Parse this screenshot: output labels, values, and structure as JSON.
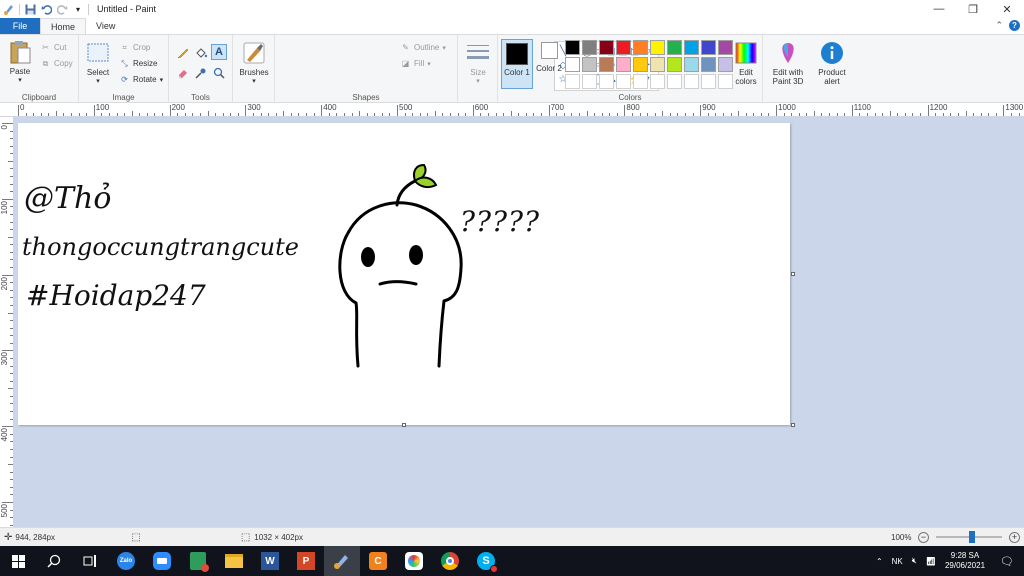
{
  "window": {
    "title": "Untitled - Paint",
    "controls": [
      "minimize-icon",
      "restore-icon",
      "close-icon"
    ]
  },
  "tabs": {
    "file": "File",
    "home": "Home",
    "view": "View"
  },
  "ribbon": {
    "clipboard": {
      "label": "Clipboard",
      "paste": "Paste",
      "cut": "Cut",
      "copy": "Copy"
    },
    "image": {
      "label": "Image",
      "select": "Select",
      "crop": "Crop",
      "resize": "Resize",
      "rotate": "Rotate"
    },
    "tools": {
      "label": "Tools"
    },
    "brushes": {
      "label": "Brushes"
    },
    "shapes": {
      "label": "Shapes",
      "outline": "Outline",
      "fill": "Fill"
    },
    "size": {
      "label": "Size"
    },
    "colors": {
      "label": "Colors",
      "color1": "Color 1",
      "color2": "Color 2",
      "color1_value": "#000000",
      "color2_value": "#ffffff",
      "palette": [
        "#000000",
        "#7f7f7f",
        "#880015",
        "#ed1c24",
        "#ff7f27",
        "#fff200",
        "#22b14c",
        "#00a2e8",
        "#3f48cc",
        "#a349a4",
        "#ffffff",
        "#c3c3c3",
        "#b97a57",
        "#ffaec9",
        "#ffc90e",
        "#efe4b0",
        "#b5e61d",
        "#99d9ea",
        "#7092be",
        "#c8bfe7"
      ],
      "edit_colors": "Edit colors"
    },
    "paint3d": "Edit with Paint 3D",
    "product_alert": "Product alert"
  },
  "ruler": {
    "h_labels": [
      "0",
      "100",
      "200",
      "300",
      "400",
      "500",
      "600",
      "700",
      "800",
      "900",
      "1000",
      "1100",
      "1200",
      "1300"
    ],
    "v_labels": [
      "0",
      "100",
      "200",
      "300",
      "400",
      "500"
    ]
  },
  "canvas": {
    "line1": "@Thỏ",
    "line2": "thongoccungtrangcute",
    "line3": "#Hoidap247",
    "question": "?????"
  },
  "status": {
    "cursor_pos": "944, 284px",
    "canvas_size": "1032 × 402px",
    "zoom": "100%",
    "zoom_level": 0.55
  },
  "taskbar": {
    "apps": [
      "windows-start-icon",
      "search-icon",
      "task-view-icon",
      "zalo-icon",
      "zoom-icon",
      "app-icon",
      "file-explorer-icon",
      "word-icon",
      "powerpoint-icon",
      "paint-icon",
      "app-orange-icon",
      "app-color-icon",
      "chrome-icon",
      "skype-icon"
    ],
    "time": "9:28 SA",
    "date": "29/06/2021"
  }
}
